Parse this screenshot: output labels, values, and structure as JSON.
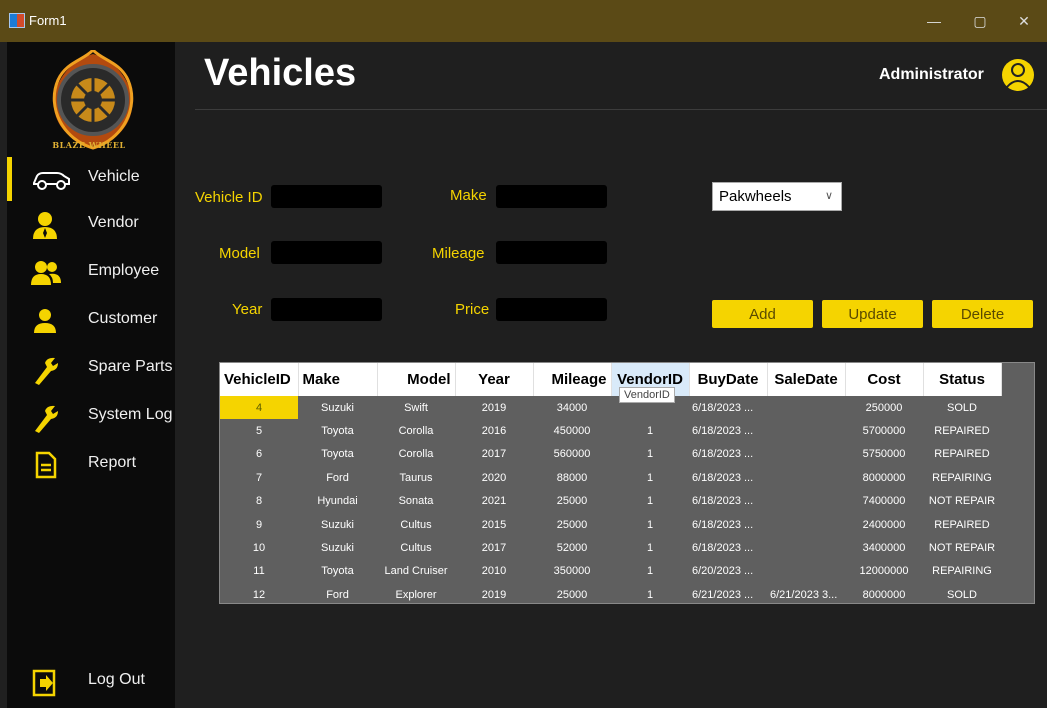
{
  "window": {
    "title": "Form1",
    "minimize": "—",
    "maximize": "▢",
    "close": "✕"
  },
  "brand": {
    "logo_text": "BLAZE WHEEL"
  },
  "nav": [
    {
      "label": "Vehicle",
      "icon": "car-icon"
    },
    {
      "label": "Vendor",
      "icon": "vendor-user-icon"
    },
    {
      "label": "Employee",
      "icon": "group-icon"
    },
    {
      "label": "Customer",
      "icon": "person-icon"
    },
    {
      "label": "Spare Parts",
      "icon": "wrench-icon"
    },
    {
      "label": "System Log",
      "icon": "wrench-icon"
    },
    {
      "label": "Report",
      "icon": "document-icon"
    }
  ],
  "logout": {
    "label": "Log Out",
    "icon": "logout-icon"
  },
  "header": {
    "title": "Vehicles",
    "user": "Administrator"
  },
  "form": {
    "vehicle_id_label": "Vehicle ID",
    "make_label": "Make",
    "model_label": "Model",
    "mileage_label": "Mileage",
    "year_label": "Year",
    "price_label": "Price",
    "source_select": "Pakwheels",
    "add_label": "Add",
    "update_label": "Update",
    "delete_label": "Delete"
  },
  "colors": {
    "accent": "#f5d400",
    "sidebar": "#0b0b0b",
    "titlebar": "#5b4a16",
    "background": "#1f1f1f"
  },
  "grid": {
    "columns": [
      "VehicleID",
      "Make",
      "Model",
      "Year",
      "Mileage",
      "VendorID",
      "BuyDate",
      "SaleDate",
      "Cost",
      "Status"
    ],
    "tooltip": "VendorID",
    "rows": [
      [
        "4",
        "Suzuki",
        "Swift",
        "2019",
        "34000",
        "",
        "6/18/2023 ...",
        "",
        "250000",
        "SOLD"
      ],
      [
        "5",
        "Toyota",
        "Corolla",
        "2016",
        "450000",
        "1",
        "6/18/2023 ...",
        "",
        "5700000",
        "REPAIRED"
      ],
      [
        "6",
        "Toyota",
        "Corolla",
        "2017",
        "560000",
        "1",
        "6/18/2023 ...",
        "",
        "5750000",
        "REPAIRED"
      ],
      [
        "7",
        "Ford",
        "Taurus",
        "2020",
        "88000",
        "1",
        "6/18/2023 ...",
        "",
        "8000000",
        "REPAIRING"
      ],
      [
        "8",
        "Hyundai",
        "Sonata",
        "2021",
        "25000",
        "1",
        "6/18/2023 ...",
        "",
        "7400000",
        "NOT REPAIR"
      ],
      [
        "9",
        "Suzuki",
        "Cultus",
        "2015",
        "25000",
        "1",
        "6/18/2023 ...",
        "",
        "2400000",
        "REPAIRED"
      ],
      [
        "10",
        "Suzuki",
        "Cultus",
        "2017",
        "52000",
        "1",
        "6/18/2023 ...",
        "",
        "3400000",
        "NOT REPAIR"
      ],
      [
        "11",
        "Toyota",
        "Land Cruiser",
        "2010",
        "350000",
        "1",
        "6/20/2023 ...",
        "",
        "12000000",
        "REPAIRING"
      ],
      [
        "12",
        "Ford",
        "Explorer",
        "2019",
        "25000",
        "1",
        "6/21/2023 ...",
        "6/21/2023 3...",
        "8000000",
        "SOLD"
      ]
    ]
  }
}
